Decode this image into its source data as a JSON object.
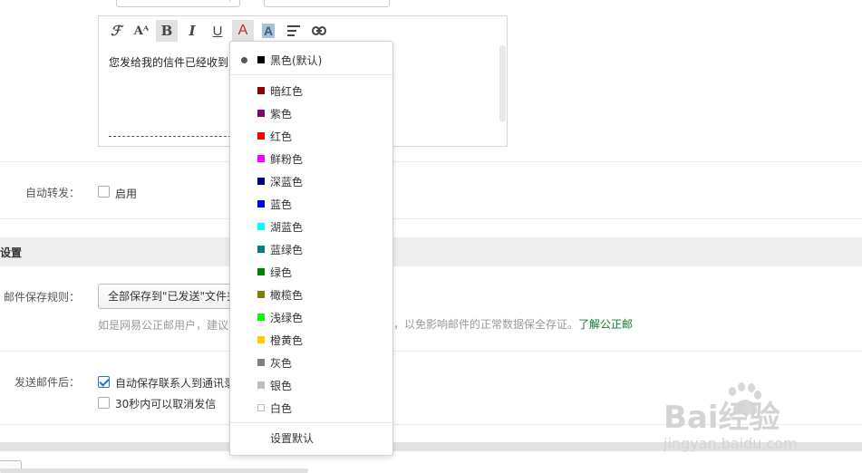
{
  "editor": {
    "body_text": "您发给我的信件已经收到",
    "toolbar": {
      "font_icon": "ℱ",
      "size_icon": "Aᴬ",
      "bold_icon": "B",
      "italic_icon": "I",
      "underline_icon": "U",
      "font_color_icon": "A",
      "bg_color_icon": "A"
    }
  },
  "auto_forward": {
    "label": "自动转发：",
    "enable_label": "启用"
  },
  "section": {
    "title": "设置"
  },
  "save_rule": {
    "label": "邮件保存规则：",
    "select_value": "全部保存到\"已发送\"文件夹",
    "hint_before": "如是网易公正邮用户，建议",
    "hint_after": "，以免影响邮件的正常数据保全存证。",
    "hint_link": "了解公正邮"
  },
  "after_send": {
    "label": "发送邮件后：",
    "option1": "自动保存联系人到通讯录",
    "option2": "30秒内可以取消发信"
  },
  "color_menu": {
    "default_item": {
      "label": "黑色(默认)",
      "color": "#000000"
    },
    "items": [
      {
        "label": "暗红色",
        "color": "#8b0000"
      },
      {
        "label": "紫色",
        "color": "#800080"
      },
      {
        "label": "红色",
        "color": "#ff0000"
      },
      {
        "label": "鲜粉色",
        "color": "#ff00ff"
      },
      {
        "label": "深蓝色",
        "color": "#000080"
      },
      {
        "label": "蓝色",
        "color": "#0000ff"
      },
      {
        "label": "湖蓝色",
        "color": "#00ffff"
      },
      {
        "label": "蓝绿色",
        "color": "#008080"
      },
      {
        "label": "绿色",
        "color": "#008000"
      },
      {
        "label": "橄榄色",
        "color": "#808000"
      },
      {
        "label": "浅绿色",
        "color": "#00ff00"
      },
      {
        "label": "橙黄色",
        "color": "#ffcc00"
      },
      {
        "label": "灰色",
        "color": "#808080"
      },
      {
        "label": "银色",
        "color": "#c0c0c0"
      },
      {
        "label": "白色",
        "color": "#ffffff"
      }
    ],
    "set_default": "设置默认"
  },
  "watermark": {
    "brand": "Bai经验",
    "url": "jingyan.baidu.com"
  }
}
